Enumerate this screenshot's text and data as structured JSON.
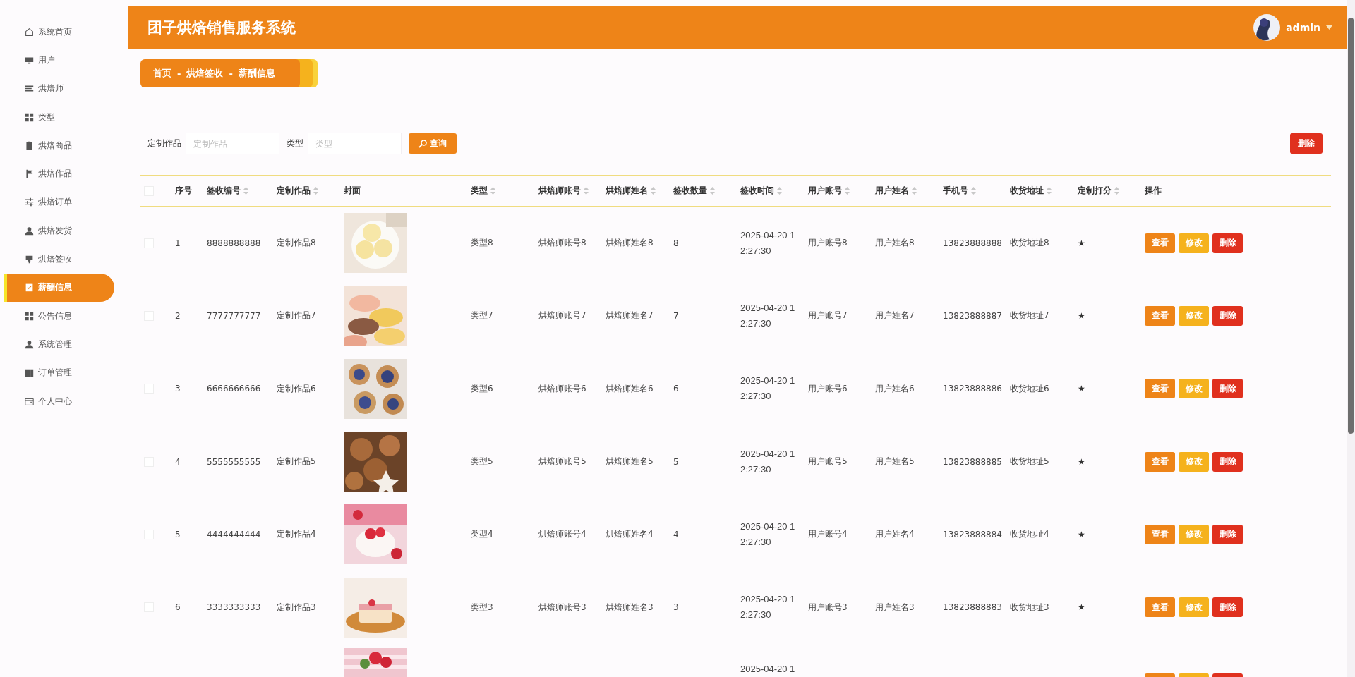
{
  "sidebar": {
    "items": [
      {
        "label": "系统首页",
        "selected": false
      },
      {
        "label": "用户",
        "selected": false
      },
      {
        "label": "烘焙师",
        "selected": false
      },
      {
        "label": "类型",
        "selected": false
      },
      {
        "label": "烘焙商品",
        "selected": false
      },
      {
        "label": "烘焙作品",
        "selected": false
      },
      {
        "label": "烘焙订单",
        "selected": false
      },
      {
        "label": "烘焙发货",
        "selected": false
      },
      {
        "label": "烘焙签收",
        "selected": false
      },
      {
        "label": "薪酬信息",
        "selected": true
      },
      {
        "label": "公告信息",
        "selected": false
      },
      {
        "label": "系统管理",
        "selected": false
      },
      {
        "label": "订单管理",
        "selected": false
      },
      {
        "label": "个人中心",
        "selected": false
      }
    ]
  },
  "header": {
    "title": "团子烘焙销售服务系统",
    "user": "admin"
  },
  "breadcrumb": [
    "首页",
    "-",
    "烘焙签收",
    "-",
    "薪酬信息"
  ],
  "search": {
    "fields": [
      {
        "label": "定制作品",
        "placeholder": "定制作品"
      },
      {
        "label": "类型",
        "placeholder": "类型"
      }
    ],
    "button": "查询",
    "delete_button": "删除"
  },
  "table": {
    "select_all": {
      "checked": false
    },
    "columns": [
      {
        "label": "序号",
        "sortable": false
      },
      {
        "label": "签收编号",
        "sortable": true
      },
      {
        "label": "定制作品",
        "sortable": true
      },
      {
        "label": "封面",
        "sortable": false
      },
      {
        "label": "类型",
        "sortable": true
      },
      {
        "label": "烘焙师账号",
        "sortable": true
      },
      {
        "label": "烘焙师姓名",
        "sortable": true
      },
      {
        "label": "签收数量",
        "sortable": true
      },
      {
        "label": "签收时间",
        "sortable": true
      },
      {
        "label": "用户账号",
        "sortable": true
      },
      {
        "label": "用户姓名",
        "sortable": true
      },
      {
        "label": "手机号",
        "sortable": true
      },
      {
        "label": "收货地址",
        "sortable": true
      },
      {
        "label": "定制打分",
        "sortable": true
      },
      {
        "label": "操作",
        "sortable": false
      }
    ],
    "rows": [
      {
        "kind": "full",
        "checked": false,
        "cells": [
          "1",
          "8888888888",
          "定制作品8"
        ],
        "cells2": [
          "类型8",
          "烘焙师账号8",
          "烘焙师姓名8",
          "8",
          "2025-04-20 12:27:30",
          "用户账号8",
          "用户姓名8",
          "13823888888",
          "收货地址8"
        ],
        "rating": "★",
        "actions": [
          "查看",
          "修改",
          "删除"
        ]
      },
      {
        "kind": "full",
        "checked": false,
        "cells": [
          "2",
          "7777777777",
          "定制作品7"
        ],
        "cells2": [
          "类型7",
          "烘焙师账号7",
          "烘焙师姓名7",
          "7",
          "2025-04-20 12:27:30",
          "用户账号7",
          "用户姓名7",
          "13823888887",
          "收货地址7"
        ],
        "rating": "★",
        "actions": [
          "查看",
          "修改",
          "删除"
        ]
      },
      {
        "kind": "full",
        "checked": false,
        "cells": [
          "3",
          "6666666666",
          "定制作品6"
        ],
        "cells2": [
          "类型6",
          "烘焙师账号6",
          "烘焙师姓名6",
          "6",
          "2025-04-20 12:27:30",
          "用户账号6",
          "用户姓名6",
          "13823888886",
          "收货地址6"
        ],
        "rating": "★",
        "actions": [
          "查看",
          "修改",
          "删除"
        ]
      },
      {
        "kind": "full",
        "checked": false,
        "cells": [
          "4",
          "5555555555",
          "定制作品5"
        ],
        "cells2": [
          "类型5",
          "烘焙师账号5",
          "烘焙师姓名5",
          "5",
          "2025-04-20 12:27:30",
          "用户账号5",
          "用户姓名5",
          "13823888885",
          "收货地址5"
        ],
        "rating": "★",
        "actions": [
          "查看",
          "修改",
          "删除"
        ]
      },
      {
        "kind": "full",
        "checked": false,
        "cells": [
          "5",
          "4444444444",
          "定制作品4"
        ],
        "cells2": [
          "类型4",
          "烘焙师账号4",
          "烘焙师姓名4",
          "4",
          "2025-04-20 12:27:30",
          "用户账号4",
          "用户姓名4",
          "13823888884",
          "收货地址4"
        ],
        "rating": "★",
        "actions": [
          "查看",
          "修改",
          "删除"
        ]
      },
      {
        "kind": "full",
        "checked": false,
        "cells": [
          "6",
          "3333333333",
          "定制作品3"
        ],
        "cells2": [
          "类型3",
          "烘焙师账号3",
          "烘焙师姓名3",
          "3",
          "2025-04-20 12:27:30",
          "用户账号3",
          "用户姓名3",
          "13823888883",
          "收货地址3"
        ],
        "rating": "★",
        "actions": [
          "查看",
          "修改",
          "删除"
        ]
      },
      {
        "kind": "partial",
        "time": "2025-04-20 1"
      }
    ]
  }
}
